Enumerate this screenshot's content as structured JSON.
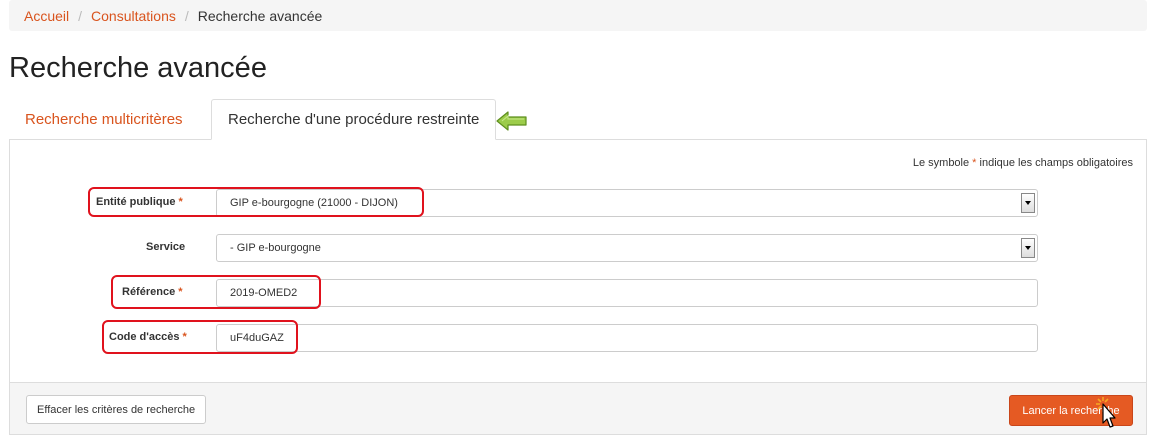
{
  "breadcrumb": {
    "home": "Accueil",
    "consultations": "Consultations",
    "current": "Recherche avancée"
  },
  "page": {
    "title": "Recherche avancée"
  },
  "tabs": [
    {
      "label": "Recherche multicritères"
    },
    {
      "label": "Recherche d'une procédure restreinte"
    }
  ],
  "form": {
    "mandatory_note_prefix": "Le symbole ",
    "mandatory_star": "*",
    "mandatory_note_suffix": " indique les champs obligatoires",
    "entity_label": "Entité publique",
    "entity_value": "GIP e-bourgogne (21000 - DIJON)",
    "service_label": "Service",
    "service_value": "- GIP e-bourgogne",
    "reference_label": "Référence",
    "reference_value": "2019-OMED2",
    "access_code_label": "Code d'accès",
    "access_code_value": "uF4duGAZ"
  },
  "actions": {
    "clear_label": "Effacer les critères de recherche",
    "search_label": "Lancer la recherche"
  },
  "colors": {
    "accent": "#d9541e",
    "button_bg": "#e55a23",
    "highlight": "#e0121d"
  }
}
